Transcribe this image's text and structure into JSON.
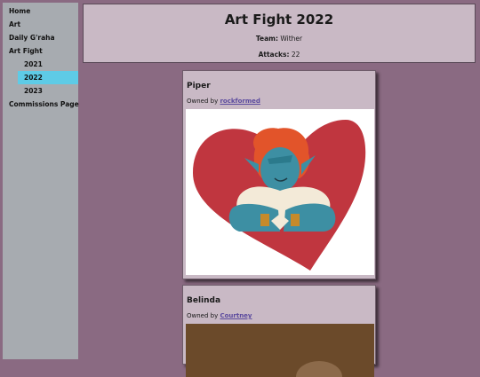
{
  "sidebar": {
    "items": [
      {
        "label": "Home"
      },
      {
        "label": "Art"
      },
      {
        "label": "Daily G'raha"
      },
      {
        "label": "Art Fight"
      },
      {
        "label": "2021"
      },
      {
        "label": "2022"
      },
      {
        "label": "2023"
      },
      {
        "label": "Commissions Page"
      }
    ],
    "active_index": 5,
    "active_color": "#5ecbe6"
  },
  "header": {
    "title": "Art Fight 2022",
    "team_label": "Team:",
    "team_value": "Wither",
    "attacks_label": "Attacks:",
    "attacks_value": "22"
  },
  "cards": [
    {
      "name": "Piper",
      "owned_by": "Owned by",
      "owner": "rockformed"
    },
    {
      "name": "Belinda",
      "owned_by": "Owned by",
      "owner": "Courtney"
    }
  ],
  "colors": {
    "background": "#8a6a82",
    "panel": "#c9b9c5",
    "sidebar": "#a7abb0",
    "link": "#5b4a9e"
  }
}
